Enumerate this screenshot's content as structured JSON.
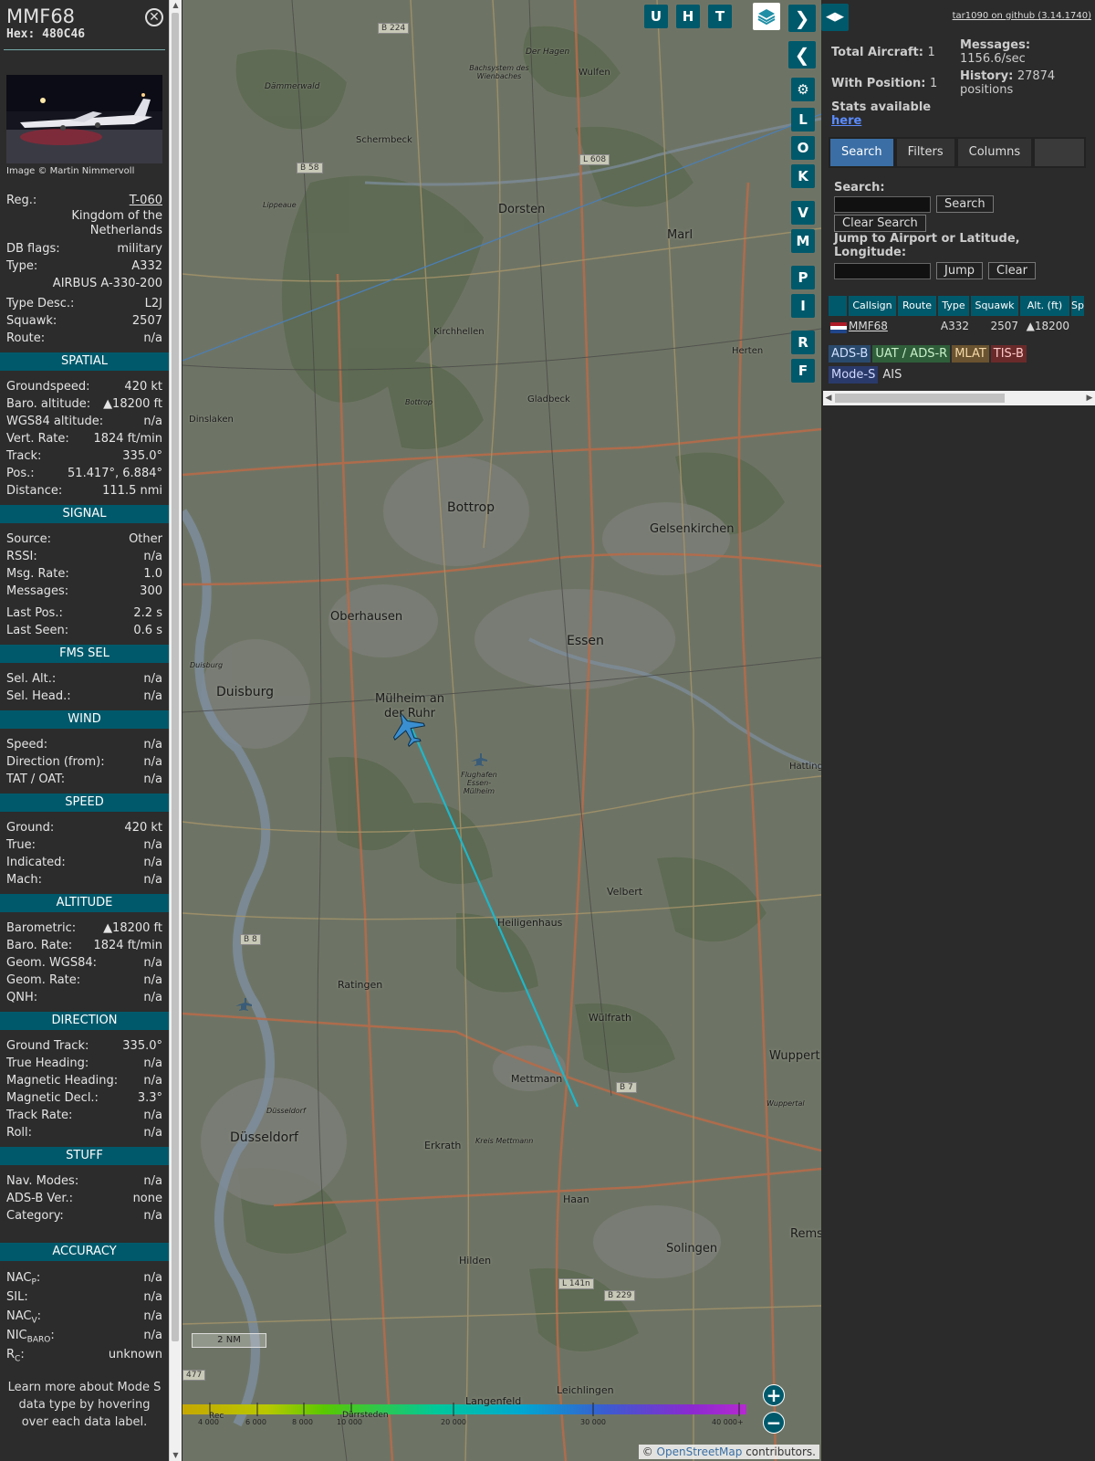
{
  "selected": {
    "callsign": "MMF68",
    "hex": "Hex: 480C46",
    "photo_credit": "Image © Martin Nimmervoll",
    "reg_label": "Reg.:",
    "reg_value": "T-060",
    "country": "Kingdom of the\nNetherlands",
    "db_flags_label": "DB flags:",
    "db_flags_value": "military",
    "type_label": "Type:",
    "type_value": "A332",
    "type_name": "AIRBUS A-330-200",
    "type_desc_label": "Type Desc.:",
    "type_desc_value": "L2J",
    "squawk_label": "Squawk:",
    "squawk_value": "2507",
    "route_label": "Route:",
    "route_value": "n/a"
  },
  "spatial": {
    "title": "SPATIAL",
    "rows": [
      {
        "label": "Groundspeed:",
        "value": "420 kt"
      },
      {
        "label": "Baro. altitude:",
        "value": "▲18200 ft"
      },
      {
        "label": "WGS84 altitude:",
        "value": "n/a"
      },
      {
        "label": "Vert. Rate:",
        "value": "1824 ft/min"
      },
      {
        "label": "Track:",
        "value": "335.0°"
      },
      {
        "label": "Pos.:",
        "value": "51.417°, 6.884°"
      },
      {
        "label": "Distance:",
        "value": "111.5 nmi"
      }
    ]
  },
  "signal": {
    "title": "SIGNAL",
    "rows": [
      {
        "label": "Source:",
        "value": "Other"
      },
      {
        "label": "RSSI:",
        "value": "n/a"
      },
      {
        "label": "Msg. Rate:",
        "value": "1.0"
      },
      {
        "label": "Messages:",
        "value": "300"
      },
      {
        "label": "Last Pos.:",
        "value": "2.2 s"
      },
      {
        "label": "Last Seen:",
        "value": "0.6 s"
      }
    ]
  },
  "fms": {
    "title": "FMS SEL",
    "rows": [
      {
        "label": "Sel. Alt.:",
        "value": "n/a"
      },
      {
        "label": "Sel. Head.:",
        "value": "n/a"
      }
    ]
  },
  "wind": {
    "title": "WIND",
    "rows": [
      {
        "label": "Speed:",
        "value": "n/a"
      },
      {
        "label": "Direction (from):",
        "value": "n/a"
      },
      {
        "label": "TAT / OAT:",
        "value": "n/a"
      }
    ]
  },
  "speed": {
    "title": "SPEED",
    "rows": [
      {
        "label": "Ground:",
        "value": "420 kt"
      },
      {
        "label": "True:",
        "value": "n/a"
      },
      {
        "label": "Indicated:",
        "value": "n/a"
      },
      {
        "label": "Mach:",
        "value": "n/a"
      }
    ]
  },
  "altitude": {
    "title": "ALTITUDE",
    "rows": [
      {
        "label": "Barometric:",
        "value": "▲18200 ft"
      },
      {
        "label": "Baro. Rate:",
        "value": "1824 ft/min"
      },
      {
        "label": "Geom. WGS84:",
        "value": "n/a"
      },
      {
        "label": "Geom. Rate:",
        "value": "n/a"
      },
      {
        "label": "QNH:",
        "value": "n/a"
      }
    ]
  },
  "direction": {
    "title": "DIRECTION",
    "rows": [
      {
        "label": "Ground Track:",
        "value": "335.0°"
      },
      {
        "label": "True Heading:",
        "value": "n/a"
      },
      {
        "label": "Magnetic Heading:",
        "value": "n/a"
      },
      {
        "label": "Magnetic Decl.:",
        "value": "3.3°"
      },
      {
        "label": "Track Rate:",
        "value": "n/a"
      },
      {
        "label": "Roll:",
        "value": "n/a"
      }
    ]
  },
  "stuff": {
    "title": "STUFF",
    "rows": [
      {
        "label": "Nav. Modes:",
        "value": "n/a"
      },
      {
        "label": "ADS-B Ver.:",
        "value": "none"
      },
      {
        "label": "Category:",
        "value": "n/a"
      }
    ]
  },
  "accuracy": {
    "title": "ACCURACY",
    "nacp_base": "NAC",
    "nacp_sub": "P",
    "nacp_value": "n/a",
    "sil_label": "SIL:",
    "sil_value": "n/a",
    "nacv_base": "NAC",
    "nacv_sub": "V",
    "nacv_value": "n/a",
    "nicbaro_base": "NIC",
    "nicbaro_sub": "BARO",
    "nicbaro_value": "n/a",
    "rc_base": "R",
    "rc_sub": "C",
    "rc_value": "unknown",
    "colon": ":"
  },
  "learn_more": "Learn more about Mode S data type by hovering over each data label.",
  "map": {
    "buttons_top": [
      "U",
      "H",
      "T"
    ],
    "side_buttons": [
      "L",
      "O",
      "K",
      "V",
      "M",
      "P",
      "I",
      "R",
      "F"
    ],
    "layers_icon": "layers-icon",
    "zoom_in": "+",
    "zoom_out": "−",
    "scale": "2 NM",
    "attribution_prefix": "© ",
    "attribution_link": "OpenStreetMap",
    "attribution_suffix": " contributors.",
    "altitude_ticks": [
      "4 000",
      "6 000",
      "8 000",
      "10 000",
      "20 000",
      "30 000",
      "40 000+"
    ],
    "cities": [
      "Dorsten",
      "Marl",
      "Bottrop",
      "Gelsenkirchen",
      "Oberhausen",
      "Essen",
      "Duisburg",
      "Mülheim an der Ruhr",
      "Velbert",
      "Heiligenhaus",
      "Ratingen",
      "Wülfrath",
      "Mettmann",
      "Düsseldorf",
      "Erkrath",
      "Haan",
      "Solingen",
      "Hilden",
      "Leichlingen",
      "Langenfeld",
      "Wuppert",
      "Rems"
    ],
    "towns": [
      "Schermbeck",
      "Wulfen",
      "Dämmerwald",
      "Der Hagen",
      "Bachsystem des Wienbaches",
      "Lippeaue",
      "Kirchhellen",
      "Gladbeck",
      "Herten",
      "Dinslaken",
      "Bottrop",
      "Hattinge",
      "Flughafen Essen-Mülheim",
      "Duisburg",
      "Düsseldorf",
      "Wuppertal",
      "Kreis Mettmann",
      "Dürrsteden",
      "Rec"
    ],
    "roads": [
      "B 224",
      "B 58",
      "L 608",
      "B 8",
      "B 7",
      "L 141n",
      "B 229",
      "477"
    ]
  },
  "right": {
    "github_link": "tar1090 on github (3.14.1740)",
    "total_label": "Total Aircraft:",
    "total_value": "1",
    "withpos_label": "With Position:",
    "withpos_value": "1",
    "messages_label": "Messages:",
    "messages_value": "1156.6/sec",
    "history_label": "History:",
    "history_value": "27874",
    "history_unit": "positions",
    "stats_label": "Stats available",
    "stats_link": "here",
    "tabs": [
      "Search",
      "Filters",
      "Columns"
    ],
    "search_label": "Search:",
    "search_button": "Search",
    "clear_search_button": "Clear Search",
    "jump_label": "Jump to Airport or Latitude, Longitude:",
    "jump_button": "Jump",
    "clear_button": "Clear",
    "columns": [
      "Callsign",
      "Route",
      "Type",
      "Squawk",
      "Alt. (ft)",
      "Spd"
    ],
    "row": {
      "callsign": "MMF68",
      "route": "",
      "type": "A332",
      "squawk": "2507",
      "alt": "▲18200"
    },
    "legend": [
      {
        "label": "ADS-B",
        "bg": "#2a4a6d",
        "color": "#cfe0ff"
      },
      {
        "label": "UAT / ADS-R",
        "bg": "#2f5f3a",
        "color": "#c9f0c9"
      },
      {
        "label": "MLAT",
        "bg": "#6a5330",
        "color": "#f5d9a8"
      },
      {
        "label": "TIS-B",
        "bg": "#6a2a2a",
        "color": "#ffc9c9"
      },
      {
        "label": "Mode-S",
        "bg": "#2a3a6a",
        "color": "#d0d8ff"
      },
      {
        "label": "AIS",
        "bg": "transparent",
        "color": "#ddd"
      }
    ]
  }
}
